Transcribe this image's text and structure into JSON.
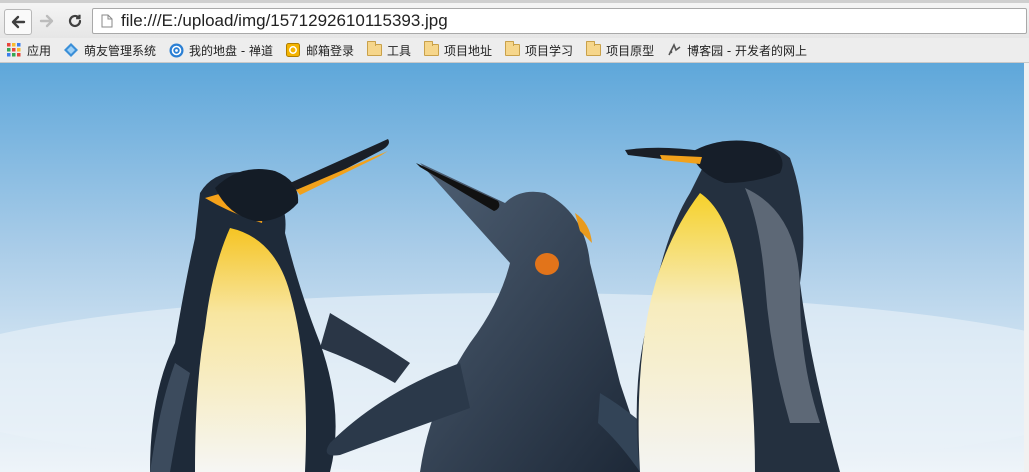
{
  "browser": {
    "url": "file:///E:/upload/img/1571292610115393.jpg",
    "back_icon": "arrow-left-icon",
    "forward_icon": "arrow-right-icon",
    "reload_icon": "reload-icon"
  },
  "bookmarks": [
    {
      "label": "应用",
      "icon": "apps-grid-icon"
    },
    {
      "label": "萌友管理系统",
      "icon": "diamond-icon"
    },
    {
      "label": "我的地盘 - 禅道",
      "icon": "zentao-icon"
    },
    {
      "label": "邮箱登录",
      "icon": "mail-icon"
    },
    {
      "label": "工具",
      "icon": "folder-icon"
    },
    {
      "label": "项目地址",
      "icon": "folder-icon"
    },
    {
      "label": "项目学习",
      "icon": "folder-icon"
    },
    {
      "label": "项目原型",
      "icon": "folder-icon"
    },
    {
      "label": "博客园 - 开发者的网上",
      "icon": "cnblogs-icon"
    }
  ],
  "image": {
    "subject": "three king penguins",
    "colors": {
      "sky_top": "#6fb0dc",
      "sky_bottom": "#e3eef6",
      "body_dark": "#1f2b3a",
      "belly": "#f4f4f2",
      "orange": "#f3a51a",
      "yellow": "#f6d23c"
    }
  }
}
